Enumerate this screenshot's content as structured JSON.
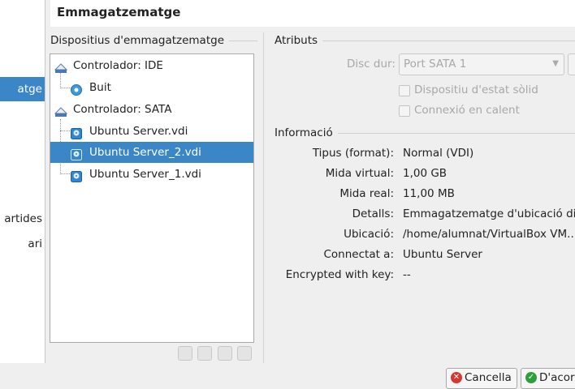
{
  "nav": {
    "items": [
      {
        "label": "atge",
        "selected": true
      },
      {
        "label": "artides",
        "selected": false
      },
      {
        "label": "ari",
        "selected": false
      }
    ]
  },
  "header": {
    "title": "Emmagatzematge"
  },
  "storage": {
    "group_title": "Dispositius d'emmagatzematge",
    "tree": [
      {
        "label": "Controlador: IDE",
        "kind": "controller-ide"
      },
      {
        "label": "Buit",
        "kind": "optical"
      },
      {
        "label": "Controlador: SATA",
        "kind": "controller-sata"
      },
      {
        "label": "Ubuntu Server.vdi",
        "kind": "disk"
      },
      {
        "label": "Ubuntu Server_2.vdi",
        "kind": "disk",
        "selected": true
      },
      {
        "label": "Ubuntu Server_1.vdi",
        "kind": "disk"
      }
    ],
    "toolbar_icons": [
      "add-attachment-icon",
      "remove-attachment-icon",
      "add-controller-icon",
      "remove-controller-icon"
    ]
  },
  "attributes": {
    "group_title": "Atributs",
    "disk_label": "Disc dur:",
    "disk_value": "Port SATA 1",
    "ssd_label": "Dispositiu d'estat sòlid",
    "hotplug_label": "Connexió en calent"
  },
  "information": {
    "group_title": "Informació",
    "rows": [
      {
        "key": "Tipus (format):",
        "value": "Normal (VDI)"
      },
      {
        "key": "Mida virtual:",
        "value": "1,00 GB"
      },
      {
        "key": "Mida real:",
        "value": "11,00 MB"
      },
      {
        "key": "Detalls:",
        "value": "Emmagatzematge d'ubicació di..."
      },
      {
        "key": "Ubicació:",
        "value": "/home/alumnat/VirtualBox VM..."
      },
      {
        "key": "Connectat a:",
        "value": "Ubuntu Server"
      },
      {
        "key": "Encrypted with key:",
        "value": "--"
      }
    ]
  },
  "buttons": {
    "cancel": "Cancella",
    "ok": "D'acord"
  },
  "colors": {
    "selection": "#3b86c7",
    "cancel_icon": "#d9352f",
    "ok_icon": "#2e9e3e"
  }
}
